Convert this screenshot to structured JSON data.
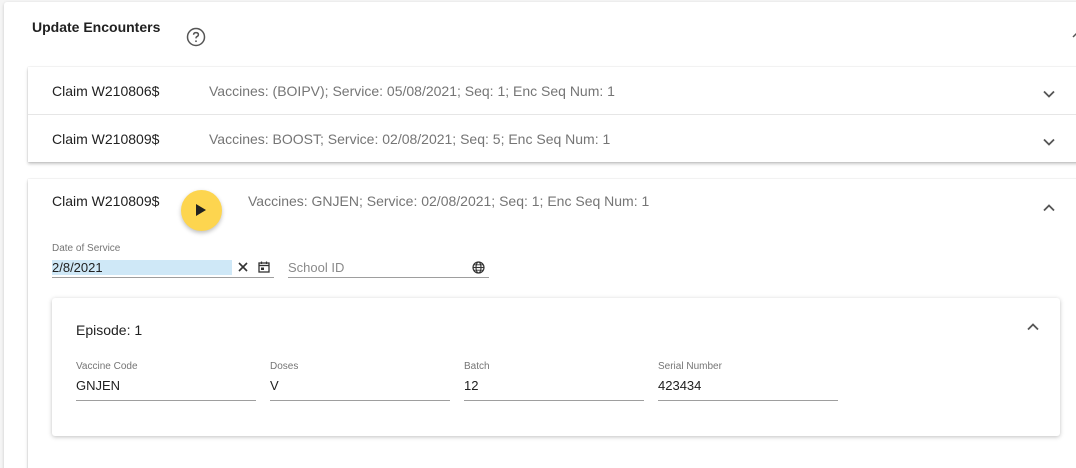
{
  "header": {
    "title": "Update Encounters",
    "help_icon": "help-circle-icon",
    "collapse_icon": "chevron-up-icon"
  },
  "claims": [
    {
      "claim": "Claim W210806$",
      "description": "Vaccines: (BOIPV); Service: 05/08/2021; Seq: 1; Enc Seq Num: 1",
      "expanded": false
    },
    {
      "claim": "Claim W210809$",
      "description": "Vaccines: BOOST; Service: 02/08/2021; Seq: 5; Enc Seq Num: 1",
      "expanded": false
    }
  ],
  "open_claim": {
    "claim": "Claim W210809$",
    "description": "Vaccines: GNJEN; Service: 02/08/2021; Seq: 1; Enc Seq Num: 1",
    "play_icon": "play-icon",
    "play_color": "#fdd54f",
    "date_of_service": {
      "label": "Date of Service",
      "value": "2/8/2021"
    },
    "school_id": {
      "placeholder": "School ID",
      "icon": "globe-icon"
    },
    "episode": {
      "title": "Episode: 1",
      "fields": [
        {
          "label": "Vaccine Code",
          "value": "GNJEN"
        },
        {
          "label": "Doses",
          "value": "V"
        },
        {
          "label": "Batch",
          "value": "12"
        },
        {
          "label": "Serial Number",
          "value": "423434"
        }
      ]
    }
  }
}
